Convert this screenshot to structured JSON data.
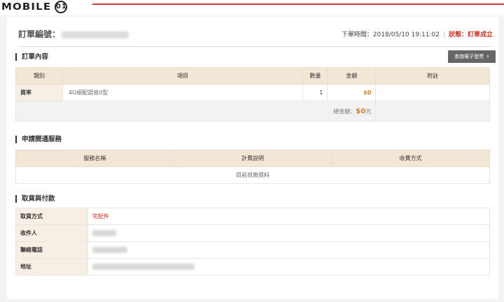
{
  "header": {
    "logo_text": "MOBILE",
    "logo_badge": "01"
  },
  "order": {
    "label": "訂單編號：",
    "time_label": "下單時間：",
    "time_value": "2018/05/10 19:11:02",
    "separator": "|",
    "status_text": "狀態：訂單成立"
  },
  "order_content": {
    "title": "訂單內容",
    "invoice_button": "查詢電子發票",
    "columns": [
      "類別",
      "項目",
      "數量",
      "金額",
      "附註"
    ],
    "rows": [
      {
        "category": "資率",
        "item": "4G絕配語音0型",
        "quantity": "1",
        "amount": "$0",
        "note": ""
      }
    ],
    "total_label": "總金額：",
    "total_value": "$0",
    "total_unit": "元"
  },
  "services": {
    "title": "申請開通服務",
    "columns": [
      "服務名稱",
      "計費說明",
      "收費方式"
    ],
    "empty_text": "目前尚無資料"
  },
  "pickup": {
    "title": "取貨與付款",
    "rows": [
      {
        "label": "取貨方式",
        "value": "宅配件"
      },
      {
        "label": "收件人",
        "value": ""
      },
      {
        "label": "聯絡電話",
        "value": ""
      },
      {
        "label": "地址",
        "value": ""
      }
    ]
  },
  "colors": {
    "accent_red": "#c0392b",
    "amount_gold": "#c9822a",
    "table_header_bg": "#f2e6d6",
    "button_bg": "#666666"
  }
}
